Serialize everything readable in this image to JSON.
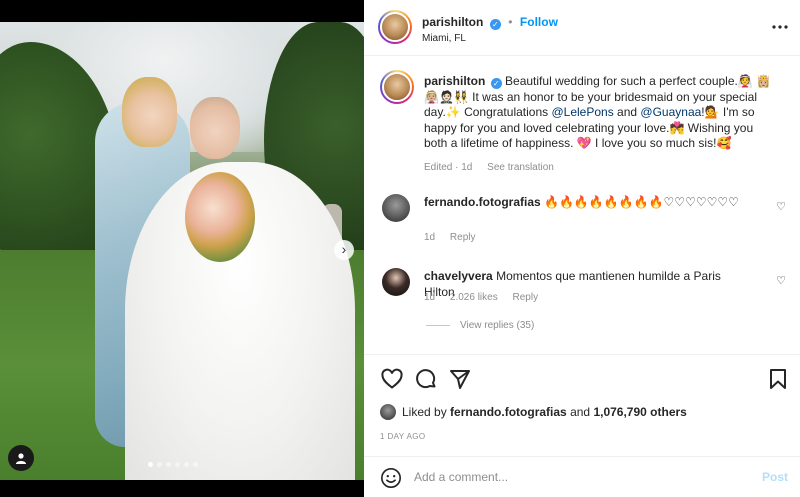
{
  "post": {
    "username": "parishilton",
    "follow_label": "Follow",
    "bullet": "•",
    "location": "Miami, FL",
    "more_label": "•••"
  },
  "caption": {
    "username": "parishilton",
    "part1": "Beautiful wedding for such a perfect couple.",
    "emoji1": "👰",
    "emoji2": "👸🏼👰🏼🤵🏻👯‍♀️",
    "part2": " It was an honor to be your bridesmaid on your special day.",
    "part3": "✨ Congratulations ",
    "mention1": "@LelePons",
    "and": " and ",
    "mention2": "@Guaynaa",
    "part4": "!💁 I'm so happy for you and loved celebrating your love.",
    "emoji3": "💏",
    "part5": " Wishing you both a lifetime of happiness. ",
    "emoji4": "💖",
    "part6": " I love you so much sis!",
    "emoji5": "🥰",
    "edited": "Edited · 1d",
    "see_translation": "See translation"
  },
  "comments": [
    {
      "username": "fernando.fotografias",
      "text": "🔥🔥🔥🔥🔥🔥🔥🔥♡♡♡♡♡♡♡",
      "time": "1d",
      "likes": "",
      "reply": "Reply"
    },
    {
      "username": "chavelyvera",
      "text": "Momentos que mantienen humilde a Paris Hilton",
      "time": "1d",
      "likes": "2.026 likes",
      "reply": "Reply"
    }
  ],
  "view_replies": "View replies (35)",
  "likes": {
    "liked_by": "Liked by",
    "user": "fernando.fotografias",
    "and": "and",
    "count": "1,076,790 others"
  },
  "date": "1 DAY AGO",
  "add_comment": {
    "placeholder": "Add a comment...",
    "post_label": "Post"
  },
  "carousel": {
    "dots": 6,
    "active": 0,
    "next_glyph": "›"
  },
  "colors": {
    "accent": "#0095f6",
    "link": "#00376b",
    "muted": "#8e8e8e"
  }
}
